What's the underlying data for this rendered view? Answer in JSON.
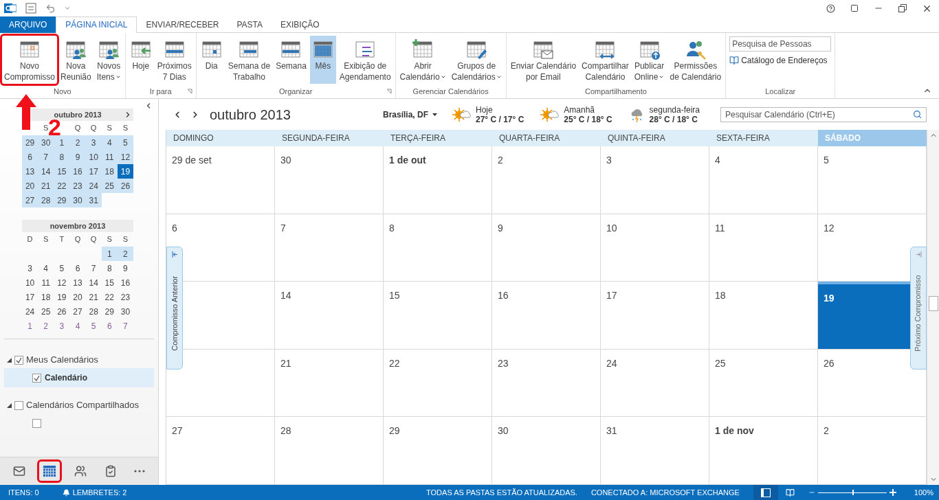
{
  "ribbon_tabs": [
    {
      "label": "ARQUIVO",
      "kind": "file",
      "selected": false
    },
    {
      "label": "PÁGINA INICIAL",
      "kind": "tab",
      "selected": true
    },
    {
      "label": "ENVIAR/RECEBER",
      "kind": "tab",
      "selected": false
    },
    {
      "label": "PASTA",
      "kind": "tab",
      "selected": false
    },
    {
      "label": "EXIBIÇÃO",
      "kind": "tab",
      "selected": false
    }
  ],
  "ribbon_groups": [
    {
      "label": "Novo",
      "kind": "buttons",
      "launcher": false,
      "buttons": [
        {
          "lines": [
            "Novo",
            "Compromisso"
          ],
          "kind": "appointment",
          "dropdown": false,
          "selected": false,
          "annotated": true
        },
        {
          "lines": [
            "Nova",
            "Reunião"
          ],
          "kind": "meeting",
          "dropdown": false,
          "selected": false,
          "annotated": false
        },
        {
          "lines": [
            "Novos",
            "Itens"
          ],
          "kind": "items",
          "dropdown": true,
          "selected": false,
          "annotated": false
        }
      ]
    },
    {
      "label": "Ir para",
      "kind": "buttons",
      "launcher": true,
      "buttons": [
        {
          "lines": [
            "Hoje"
          ],
          "kind": "today",
          "dropdown": false,
          "selected": false,
          "annotated": false
        },
        {
          "lines": [
            "Próximos",
            "7 Dias"
          ],
          "kind": "next",
          "dropdown": false,
          "selected": false,
          "annotated": false
        }
      ]
    },
    {
      "label": "Organizar",
      "kind": "buttons",
      "launcher": true,
      "buttons": [
        {
          "lines": [
            "Dia"
          ],
          "kind": "day",
          "dropdown": false,
          "selected": false,
          "annotated": false
        },
        {
          "lines": [
            "Semana de",
            "Trabalho"
          ],
          "kind": "workweek",
          "dropdown": false,
          "selected": false,
          "annotated": false
        },
        {
          "lines": [
            "Semana"
          ],
          "kind": "week",
          "dropdown": false,
          "selected": false,
          "annotated": false
        },
        {
          "lines": [
            "Mês"
          ],
          "kind": "month",
          "dropdown": false,
          "selected": true,
          "annotated": false
        },
        {
          "lines": [
            "Exibição de",
            "Agendamento"
          ],
          "kind": "schedule",
          "dropdown": false,
          "selected": false,
          "annotated": false
        }
      ]
    },
    {
      "label": "Gerenciar Calendários",
      "kind": "buttons",
      "launcher": false,
      "buttons": [
        {
          "lines": [
            "Abrir",
            "Calendário"
          ],
          "kind": "open",
          "dropdown": true,
          "selected": false,
          "annotated": false
        },
        {
          "lines": [
            "Grupos de",
            "Calendários"
          ],
          "kind": "groups",
          "dropdown": true,
          "selected": false,
          "annotated": false
        }
      ]
    },
    {
      "label": "Compartilhamento",
      "kind": "buttons",
      "launcher": false,
      "buttons": [
        {
          "lines": [
            "Enviar Calendário",
            "por Email"
          ],
          "kind": "email",
          "dropdown": false,
          "selected": false,
          "annotated": false
        },
        {
          "lines": [
            "Compartilhar",
            "Calendário"
          ],
          "kind": "share",
          "dropdown": false,
          "selected": false,
          "annotated": false
        },
        {
          "lines": [
            "Publicar",
            "Online"
          ],
          "kind": "publish",
          "dropdown": true,
          "selected": false,
          "annotated": false
        },
        {
          "lines": [
            "Permissões",
            "de Calendário"
          ],
          "kind": "permissions",
          "dropdown": false,
          "selected": false,
          "annotated": false
        }
      ]
    },
    {
      "label": "Localizar",
      "kind": "find",
      "launcher": false,
      "placeholder": "Pesquisa de Pessoas",
      "link": "Catálogo de Endereços"
    }
  ],
  "annotation": {
    "label": "2"
  },
  "mini_calendars": [
    {
      "title": "outubro 2013",
      "next": true,
      "weekdays": [
        {
          "kind": "blank"
        },
        {
          "kind": "label",
          "label": "S"
        },
        {
          "kind": "blank"
        },
        {
          "kind": "label",
          "label": "Q"
        },
        {
          "kind": "label",
          "label": "Q"
        },
        {
          "kind": "label",
          "label": "S"
        },
        {
          "kind": "label",
          "label": "S"
        }
      ],
      "weeks": [
        [
          {
            "kind": "day",
            "label": "29",
            "shaded": true,
            "today": false,
            "dim": false
          },
          {
            "kind": "day",
            "label": "30",
            "shaded": true,
            "today": false,
            "dim": false
          },
          {
            "kind": "day",
            "label": "1",
            "shaded": true,
            "today": false,
            "dim": false
          },
          {
            "kind": "day",
            "label": "2",
            "shaded": true,
            "today": false,
            "dim": false
          },
          {
            "kind": "day",
            "label": "3",
            "shaded": true,
            "today": false,
            "dim": false
          },
          {
            "kind": "day",
            "label": "4",
            "shaded": true,
            "today": false,
            "dim": false
          },
          {
            "kind": "day",
            "label": "5",
            "shaded": true,
            "today": false,
            "dim": false
          }
        ],
        [
          {
            "kind": "day",
            "label": "6",
            "shaded": true,
            "today": false,
            "dim": false
          },
          {
            "kind": "day",
            "label": "7",
            "shaded": true,
            "today": false,
            "dim": false
          },
          {
            "kind": "day",
            "label": "8",
            "shaded": true,
            "today": false,
            "dim": false
          },
          {
            "kind": "day",
            "label": "9",
            "shaded": true,
            "today": false,
            "dim": false
          },
          {
            "kind": "day",
            "label": "10",
            "shaded": true,
            "today": false,
            "dim": false
          },
          {
            "kind": "day",
            "label": "11",
            "shaded": true,
            "today": false,
            "dim": false
          },
          {
            "kind": "day",
            "label": "12",
            "shaded": true,
            "today": false,
            "dim": false
          }
        ],
        [
          {
            "kind": "day",
            "label": "13",
            "shaded": true,
            "today": false,
            "dim": false
          },
          {
            "kind": "day",
            "label": "14",
            "shaded": true,
            "today": false,
            "dim": false
          },
          {
            "kind": "day",
            "label": "15",
            "shaded": true,
            "today": false,
            "dim": false
          },
          {
            "kind": "day",
            "label": "16",
            "shaded": true,
            "today": false,
            "dim": false
          },
          {
            "kind": "day",
            "label": "17",
            "shaded": true,
            "today": false,
            "dim": false
          },
          {
            "kind": "day",
            "label": "18",
            "shaded": true,
            "today": false,
            "dim": false
          },
          {
            "kind": "day",
            "label": "19",
            "shaded": true,
            "today": true,
            "dim": false
          }
        ],
        [
          {
            "kind": "day",
            "label": "20",
            "shaded": true,
            "today": false,
            "dim": false
          },
          {
            "kind": "day",
            "label": "21",
            "shaded": true,
            "today": false,
            "dim": false
          },
          {
            "kind": "day",
            "label": "22",
            "shaded": true,
            "today": false,
            "dim": false
          },
          {
            "kind": "day",
            "label": "23",
            "shaded": true,
            "today": false,
            "dim": false
          },
          {
            "kind": "day",
            "label": "24",
            "shaded": true,
            "today": false,
            "dim": false
          },
          {
            "kind": "day",
            "label": "25",
            "shaded": true,
            "today": false,
            "dim": false
          },
          {
            "kind": "day",
            "label": "26",
            "shaded": true,
            "today": false,
            "dim": false
          }
        ],
        [
          {
            "kind": "day",
            "label": "27",
            "shaded": true,
            "today": false,
            "dim": false
          },
          {
            "kind": "day",
            "label": "28",
            "shaded": true,
            "today": false,
            "dim": false
          },
          {
            "kind": "day",
            "label": "29",
            "shaded": true,
            "today": false,
            "dim": false
          },
          {
            "kind": "day",
            "label": "30",
            "shaded": true,
            "today": false,
            "dim": false
          },
          {
            "kind": "day",
            "label": "31",
            "shaded": true,
            "today": false,
            "dim": false
          },
          {
            "kind": "blank"
          },
          {
            "kind": "blank"
          }
        ]
      ]
    },
    {
      "title": "novembro 2013",
      "next": false,
      "weekdays": [
        {
          "kind": "label",
          "label": "D"
        },
        {
          "kind": "label",
          "label": "S"
        },
        {
          "kind": "label",
          "label": "T"
        },
        {
          "kind": "label",
          "label": "Q"
        },
        {
          "kind": "label",
          "label": "Q"
        },
        {
          "kind": "label",
          "label": "S"
        },
        {
          "kind": "label",
          "label": "S"
        }
      ],
      "weeks": [
        [
          {
            "kind": "blank"
          },
          {
            "kind": "blank"
          },
          {
            "kind": "blank"
          },
          {
            "kind": "blank"
          },
          {
            "kind": "blank"
          },
          {
            "kind": "day",
            "label": "1",
            "shaded": true,
            "today": false,
            "dim": false
          },
          {
            "kind": "day",
            "label": "2",
            "shaded": true,
            "today": false,
            "dim": false
          }
        ],
        [
          {
            "kind": "day",
            "label": "3",
            "shaded": false,
            "today": false,
            "dim": false
          },
          {
            "kind": "day",
            "label": "4",
            "shaded": false,
            "today": false,
            "dim": false
          },
          {
            "kind": "day",
            "label": "5",
            "shaded": false,
            "today": false,
            "dim": false
          },
          {
            "kind": "day",
            "label": "6",
            "shaded": false,
            "today": false,
            "dim": false
          },
          {
            "kind": "day",
            "label": "7",
            "shaded": false,
            "today": false,
            "dim": false
          },
          {
            "kind": "day",
            "label": "8",
            "shaded": false,
            "today": false,
            "dim": false
          },
          {
            "kind": "day",
            "label": "9",
            "shaded": false,
            "today": false,
            "dim": false
          }
        ],
        [
          {
            "kind": "day",
            "label": "10",
            "shaded": false,
            "today": false,
            "dim": false
          },
          {
            "kind": "day",
            "label": "11",
            "shaded": false,
            "today": false,
            "dim": false
          },
          {
            "kind": "day",
            "label": "12",
            "shaded": false,
            "today": false,
            "dim": false
          },
          {
            "kind": "day",
            "label": "13",
            "shaded": false,
            "today": false,
            "dim": false
          },
          {
            "kind": "day",
            "label": "14",
            "shaded": false,
            "today": false,
            "dim": false
          },
          {
            "kind": "day",
            "label": "15",
            "shaded": false,
            "today": false,
            "dim": false
          },
          {
            "kind": "day",
            "label": "16",
            "shaded": false,
            "today": false,
            "dim": false
          }
        ],
        [
          {
            "kind": "day",
            "label": "17",
            "shaded": false,
            "today": false,
            "dim": false
          },
          {
            "kind": "day",
            "label": "18",
            "shaded": false,
            "today": false,
            "dim": false
          },
          {
            "kind": "day",
            "label": "19",
            "shaded": false,
            "today": false,
            "dim": false
          },
          {
            "kind": "day",
            "label": "20",
            "shaded": false,
            "today": false,
            "dim": false
          },
          {
            "kind": "day",
            "label": "21",
            "shaded": false,
            "today": false,
            "dim": false
          },
          {
            "kind": "day",
            "label": "22",
            "shaded": false,
            "today": false,
            "dim": false
          },
          {
            "kind": "day",
            "label": "23",
            "shaded": false,
            "today": false,
            "dim": false
          }
        ],
        [
          {
            "kind": "day",
            "label": "24",
            "shaded": false,
            "today": false,
            "dim": false
          },
          {
            "kind": "day",
            "label": "25",
            "shaded": false,
            "today": false,
            "dim": false
          },
          {
            "kind": "day",
            "label": "26",
            "shaded": false,
            "today": false,
            "dim": false
          },
          {
            "kind": "day",
            "label": "27",
            "shaded": false,
            "today": false,
            "dim": false
          },
          {
            "kind": "day",
            "label": "28",
            "shaded": false,
            "today": false,
            "dim": false
          },
          {
            "kind": "day",
            "label": "29",
            "shaded": false,
            "today": false,
            "dim": false
          },
          {
            "kind": "day",
            "label": "30",
            "shaded": false,
            "today": false,
            "dim": false
          }
        ],
        [
          {
            "kind": "day",
            "label": "1",
            "shaded": false,
            "today": false,
            "dim": true
          },
          {
            "kind": "day",
            "label": "2",
            "shaded": false,
            "today": false,
            "dim": true
          },
          {
            "kind": "day",
            "label": "3",
            "shaded": false,
            "today": false,
            "dim": true
          },
          {
            "kind": "day",
            "label": "4",
            "shaded": false,
            "today": false,
            "dim": true
          },
          {
            "kind": "day",
            "label": "5",
            "shaded": false,
            "today": false,
            "dim": true
          },
          {
            "kind": "day",
            "label": "6",
            "shaded": false,
            "today": false,
            "dim": true
          },
          {
            "kind": "day",
            "label": "7",
            "shaded": false,
            "today": false,
            "dim": true
          }
        ]
      ]
    }
  ],
  "folders": [
    {
      "label": "Meus Calendários",
      "checked": true,
      "expanded": true,
      "selected": false,
      "children": [
        {
          "label": "Calendário",
          "checked": true,
          "selected": true
        }
      ]
    },
    {
      "label": "Calendários Compartilhados",
      "checked": false,
      "expanded": true,
      "selected": false,
      "children": [
        {
          "checked": false,
          "selected": false
        }
      ]
    }
  ],
  "nav_bar": [
    {
      "kind": "mail",
      "selected": false,
      "annotated": false
    },
    {
      "kind": "calendar",
      "selected": true,
      "annotated": true
    },
    {
      "kind": "people",
      "selected": false,
      "annotated": false
    },
    {
      "kind": "tasks",
      "selected": false,
      "annotated": false
    },
    {
      "kind": "more",
      "selected": false,
      "annotated": false
    }
  ],
  "calendar": {
    "title": "outubro 2013",
    "location": "Brasília, DF",
    "weather": [
      {
        "day": "Hoje",
        "temps": "27° C / 17° C",
        "kind": "sunny"
      },
      {
        "day": "Amanhã",
        "temps": "25° C / 18° C",
        "kind": "sunny"
      },
      {
        "day": "segunda-feira",
        "temps": "28° C / 18° C",
        "kind": "storm"
      }
    ],
    "search_placeholder": "Pesquisar Calendário (Ctrl+E)",
    "weekdays": [
      {
        "label": "DOMINGO",
        "selected": false
      },
      {
        "label": "SEGUNDA-FEIRA",
        "selected": false
      },
      {
        "label": "TERÇA-FEIRA",
        "selected": false
      },
      {
        "label": "QUARTA-FEIRA",
        "selected": false
      },
      {
        "label": "QUINTA-FEIRA",
        "selected": false
      },
      {
        "label": "SEXTA-FEIRA",
        "selected": false
      },
      {
        "label": "SÁBADO",
        "selected": true
      }
    ],
    "weeks": [
      [
        {
          "kind": "day",
          "label": "29 de set",
          "bold": false,
          "today": false
        },
        {
          "kind": "day",
          "label": "30",
          "bold": false,
          "today": false
        },
        {
          "kind": "day",
          "label": "1 de out",
          "bold": true,
          "today": false
        },
        {
          "kind": "day",
          "label": "2",
          "bold": false,
          "today": false
        },
        {
          "kind": "day",
          "label": "3",
          "bold": false,
          "today": false
        },
        {
          "kind": "day",
          "label": "4",
          "bold": false,
          "today": false
        },
        {
          "kind": "day",
          "label": "5",
          "bold": false,
          "today": false
        }
      ],
      [
        {
          "kind": "day",
          "label": "6",
          "bold": false,
          "today": false
        },
        {
          "kind": "day",
          "label": "7",
          "bold": false,
          "today": false
        },
        {
          "kind": "day",
          "label": "8",
          "bold": false,
          "today": false
        },
        {
          "kind": "day",
          "label": "9",
          "bold": false,
          "today": false
        },
        {
          "kind": "day",
          "label": "10",
          "bold": false,
          "today": false
        },
        {
          "kind": "day",
          "label": "11",
          "bold": false,
          "today": false
        },
        {
          "kind": "day",
          "label": "12",
          "bold": false,
          "today": false
        }
      ],
      [
        {
          "kind": "covered"
        },
        {
          "kind": "day",
          "label": "14",
          "bold": false,
          "today": false
        },
        {
          "kind": "day",
          "label": "15",
          "bold": false,
          "today": false
        },
        {
          "kind": "day",
          "label": "16",
          "bold": false,
          "today": false
        },
        {
          "kind": "day",
          "label": "17",
          "bold": false,
          "today": false
        },
        {
          "kind": "day",
          "label": "18",
          "bold": false,
          "today": false
        },
        {
          "kind": "day",
          "label": "19",
          "bold": true,
          "today": true
        }
      ],
      [
        {
          "kind": "covered"
        },
        {
          "kind": "day",
          "label": "21",
          "bold": false,
          "today": false
        },
        {
          "kind": "day",
          "label": "22",
          "bold": false,
          "today": false
        },
        {
          "kind": "day",
          "label": "23",
          "bold": false,
          "today": false
        },
        {
          "kind": "day",
          "label": "24",
          "bold": false,
          "today": false
        },
        {
          "kind": "day",
          "label": "25",
          "bold": false,
          "today": false
        },
        {
          "kind": "day",
          "label": "26",
          "bold": false,
          "today": false
        }
      ],
      [
        {
          "kind": "day",
          "label": "27",
          "bold": false,
          "today": false
        },
        {
          "kind": "day",
          "label": "28",
          "bold": false,
          "today": false
        },
        {
          "kind": "day",
          "label": "29",
          "bold": false,
          "today": false
        },
        {
          "kind": "day",
          "label": "30",
          "bold": false,
          "today": false
        },
        {
          "kind": "day",
          "label": "31",
          "bold": false,
          "today": false
        },
        {
          "kind": "day",
          "label": "1 de nov",
          "bold": true,
          "today": false
        },
        {
          "kind": "day",
          "label": "2",
          "bold": false,
          "today": false
        }
      ]
    ],
    "side_tabs": [
      {
        "label": "Compromisso Anterior",
        "kind": "previous"
      },
      {
        "label": "Próximo Compromisso",
        "kind": "next"
      }
    ]
  },
  "status_bar": {
    "left": [
      "ITENS: 0",
      "LEMBRETES: 2"
    ],
    "right": [
      "TODAS AS PASTAS ESTÃO ATUALIZADAS.",
      "CONECTADO A: MICROSOFT EXCHANGE"
    ],
    "zoom": {
      "level": 0.5,
      "reading": "100%"
    }
  }
}
